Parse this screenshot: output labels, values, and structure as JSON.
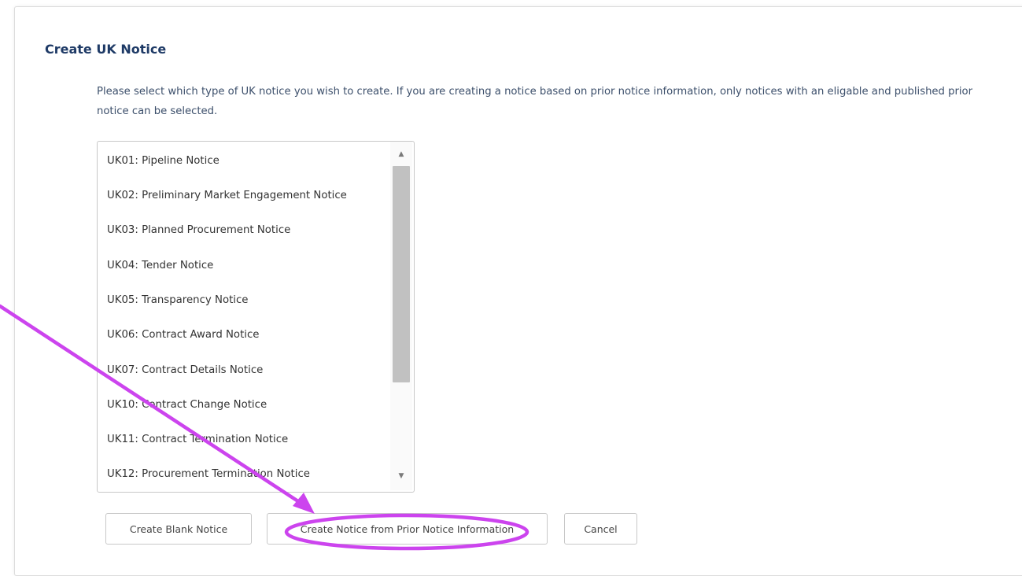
{
  "dialog": {
    "title": "Create UK Notice",
    "description": "Please select which type of UK notice you wish to create. If you are creating a notice based on prior notice information, only notices with an eligable and published prior notice can be selected."
  },
  "notice_types": [
    "UK01: Pipeline Notice",
    "UK02: Preliminary Market Engagement Notice",
    "UK03: Planned Procurement Notice",
    "UK04: Tender Notice",
    "UK05: Transparency Notice",
    "UK06: Contract Award Notice",
    "UK07: Contract Details Notice",
    "UK10: Contract Change Notice",
    "UK11: Contract Termination Notice",
    "UK12: Procurement Termination Notice"
  ],
  "buttons": {
    "create_blank": "Create Blank Notice",
    "create_from_prior": "Create Notice from Prior Notice Information",
    "cancel": "Cancel"
  },
  "annotation": {
    "color": "#cc44ee",
    "highlighted": "create-from-prior-button"
  },
  "icons": {
    "scroll_up": "caret-up-icon",
    "scroll_down": "caret-down-icon"
  }
}
